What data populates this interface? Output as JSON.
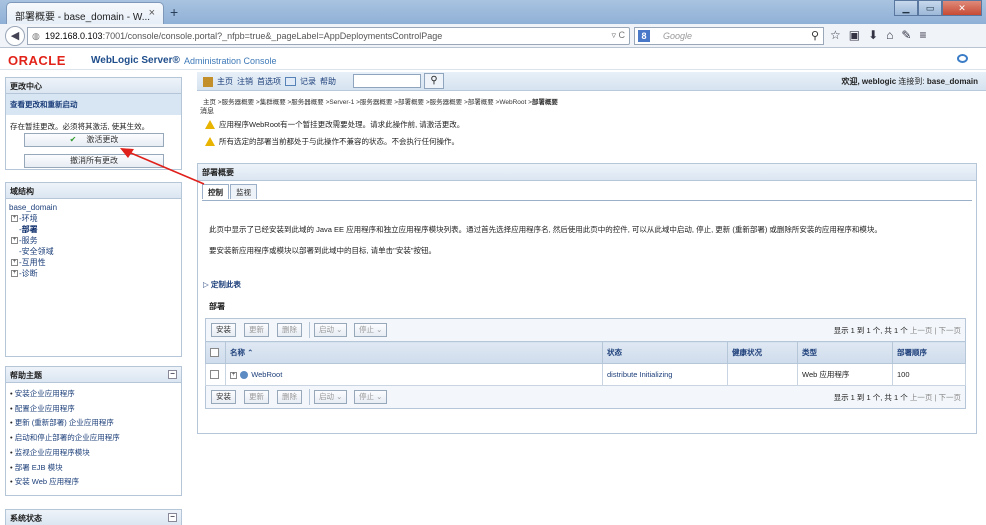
{
  "browser": {
    "tab_title": "部署概要 - base_domain - W...",
    "tab_close": "×",
    "new_tab": "+",
    "url_host": "192.168.0.103",
    "url_rest": ":7001/console/console.portal?_nfpb=true&_pageLabel=AppDeploymentsControlPage",
    "url_right": "▿ C",
    "search_engine": "Google",
    "search_placeholder": "Google",
    "nav_icons": [
      "☆",
      "▣",
      "⬇",
      "⌂",
      "✎",
      "≡"
    ]
  },
  "console": {
    "brand": "ORACLE",
    "product": "WebLogic Server®",
    "subtitle": "Administration Console"
  },
  "topbar": {
    "links": [
      "主页",
      "注销",
      "首选项",
      "记录",
      "帮助"
    ],
    "search_value": "",
    "welcome_label": "欢迎, weblogic",
    "connected_label": "连接到:",
    "domain": "base_domain"
  },
  "breadcrumb": {
    "path": "主页 >服务器概要 >集群概要 >服务器概要 >Server-1 >服务器概要 >部署概要 >服务器概要 >部署概要 >WebRoot >",
    "current": "部署概要"
  },
  "messages": {
    "title": "消息",
    "items": [
      "应用程序WebRoot有一个暂挂更改需要处理。请求此操作前, 请激活更改。",
      "所有选定的部署当前都处于与此操作不兼容的状态。不会执行任何操作。"
    ]
  },
  "change_center": {
    "title": "更改中心",
    "subtitle": "查看更改和重新启动",
    "text": "存在暂挂更改。必须将其激活, 使其生效。",
    "activate_label": "激活更改",
    "undo_label": "撤消所有更改"
  },
  "domain_tree": {
    "title": "域结构",
    "root": "base_domain",
    "items": [
      {
        "label": "环境",
        "bold": false,
        "expand": "+"
      },
      {
        "label": "部署",
        "bold": true,
        "expand": ""
      },
      {
        "label": "服务",
        "bold": false,
        "expand": "+"
      },
      {
        "label": "安全领域",
        "bold": false,
        "expand": ""
      },
      {
        "label": "互用性",
        "bold": false,
        "expand": "+"
      },
      {
        "label": "诊断",
        "bold": false,
        "expand": "+"
      }
    ]
  },
  "help_topics": {
    "title": "帮助主题",
    "toggle": "−",
    "items": [
      "安装企业应用程序",
      "配置企业应用程序",
      "更新 (重新部署) 企业应用程序",
      "启动和停止部署的企业应用程序",
      "监视企业应用程序模块",
      "部署 EJB 模块",
      "安装 Web 应用程序"
    ]
  },
  "system_status": {
    "title": "系统状态",
    "toggle": "−"
  },
  "deployments": {
    "panel_title": "部署概要",
    "tabs": [
      {
        "label": "控制",
        "active": true
      },
      {
        "label": "监视",
        "active": false
      }
    ],
    "description": "此页中显示了已经安装到此域的 Java EE 应用程序和独立应用程序模块列表。通过首先选择应用程序名, 然后使用此页中的控件, 可以从此域中启动, 停止, 更新 (重新部署) 或删除所安装的应用程序和模块。",
    "install_hint": "要安装新应用程序或模块以部署到此域中的目标, 请单击\"安装\"按钮。",
    "customize_link": "定制此表",
    "table_title": "部署",
    "buttons": {
      "install": "安装",
      "update": "更新",
      "delete": "删除",
      "start": "启动 ⌄",
      "stop": "停止 ⌄"
    },
    "pager": {
      "summary": "显示 1 到 1 个, 共 1 个",
      "prev": "上一页",
      "sep": "|",
      "next": "下一页"
    },
    "columns": [
      "名称 ⌃",
      "状态",
      "健康状况",
      "类型",
      "部署顺序"
    ],
    "rows": [
      {
        "expand": "+",
        "name": "WebRoot",
        "state": "distribute Initializing",
        "health": "",
        "type": "Web 应用程序",
        "order": "100"
      }
    ]
  }
}
